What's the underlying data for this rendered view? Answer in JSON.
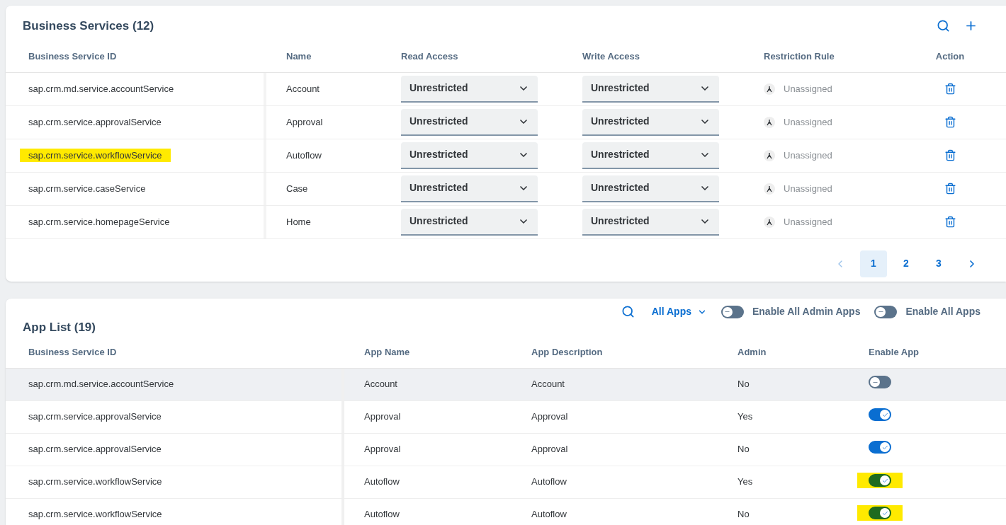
{
  "business_services": {
    "title": "Business Services (12)",
    "columns": [
      "Business Service ID",
      "Name",
      "Read Access",
      "Write Access",
      "Restriction Rule",
      "Action"
    ],
    "rows": [
      {
        "id": "sap.crm.md.service.accountService",
        "name": "Account",
        "read_access": "Unrestricted",
        "write_access": "Unrestricted",
        "restriction_rule": "Unassigned",
        "highlighted": false
      },
      {
        "id": "sap.crm.service.approvalService",
        "name": "Approval",
        "read_access": "Unrestricted",
        "write_access": "Unrestricted",
        "restriction_rule": "Unassigned",
        "highlighted": false
      },
      {
        "id": "sap.crm.service.workflowService",
        "name": "Autoflow",
        "read_access": "Unrestricted",
        "write_access": "Unrestricted",
        "restriction_rule": "Unassigned",
        "highlighted": true
      },
      {
        "id": "sap.crm.service.caseService",
        "name": "Case",
        "read_access": "Unrestricted",
        "write_access": "Unrestricted",
        "restriction_rule": "Unassigned",
        "highlighted": false
      },
      {
        "id": "sap.crm.service.homepageService",
        "name": "Home",
        "read_access": "Unrestricted",
        "write_access": "Unrestricted",
        "restriction_rule": "Unassigned",
        "highlighted": false
      }
    ],
    "pagination": [
      {
        "label": "1",
        "selected": true
      },
      {
        "label": "2",
        "selected": false
      },
      {
        "label": "3",
        "selected": false
      }
    ]
  },
  "app_list": {
    "title": "App List (19)",
    "filter": "All Apps",
    "toggles": [
      {
        "label": "Enable All Admin Apps",
        "on": false
      },
      {
        "label": "Enable All Apps",
        "on": false
      }
    ],
    "columns": [
      "Business Service ID",
      "App Name",
      "App Description",
      "Admin",
      "Enable App"
    ],
    "rows": [
      {
        "id": "sap.crm.md.service.accountService",
        "app_name": "Account",
        "description": "Account",
        "admin": "No",
        "enabled": false,
        "selected": true,
        "highlighted": false
      },
      {
        "id": "sap.crm.service.approvalService",
        "app_name": "Approval",
        "description": "Approval",
        "admin": "Yes",
        "enabled": true,
        "selected": false,
        "highlighted": false
      },
      {
        "id": "sap.crm.service.approvalService",
        "app_name": "Approval",
        "description": "Approval",
        "admin": "No",
        "enabled": true,
        "selected": false,
        "highlighted": false
      },
      {
        "id": "sap.crm.service.workflowService",
        "app_name": "Autoflow",
        "description": "Autoflow",
        "admin": "Yes",
        "enabled": true,
        "selected": false,
        "highlighted": true
      },
      {
        "id": "sap.crm.service.workflowService",
        "app_name": "Autoflow",
        "description": "Autoflow",
        "admin": "No",
        "enabled": true,
        "selected": false,
        "highlighted": true
      }
    ]
  }
}
